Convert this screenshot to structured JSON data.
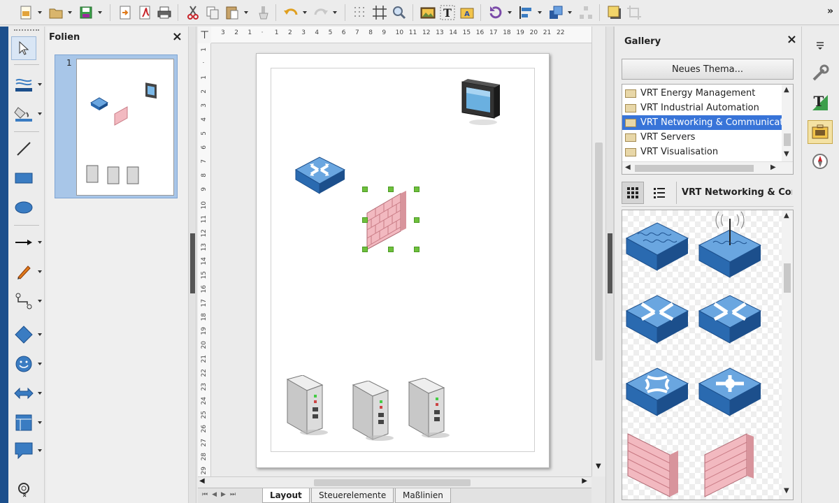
{
  "toolbar": {
    "more_label": "»",
    "icons": [
      "new-document-icon",
      "open-folder-icon",
      "save-icon",
      "export-icon",
      "export-pdf-icon",
      "print-icon",
      "cut-icon",
      "copy-icon",
      "paste-icon",
      "clone-formatting-icon",
      "undo-icon",
      "redo-icon",
      "grid-icon",
      "helplines-icon",
      "zoom-icon",
      "image-icon",
      "text-box-icon",
      "fontwork-icon",
      "rotate-icon",
      "align-icon",
      "arrange-icon",
      "distribute-icon",
      "shadow-icon",
      "crop-icon"
    ]
  },
  "tools": {
    "icons": [
      "select-icon",
      "line-color-icon",
      "fill-color-icon",
      "line-icon",
      "rectangle-icon",
      "ellipse-icon",
      "line-arrow-icon",
      "curve-icon",
      "connector-icon",
      "basic-shapes-icon",
      "symbol-shapes-icon",
      "block-arrows-icon",
      "flowchart-icon",
      "callout-icon",
      "glue-points-icon"
    ],
    "more_label": "«"
  },
  "slides_pane": {
    "title": "Folien",
    "close_label": "×",
    "slide_number": "1"
  },
  "ruler": {
    "h_ticks": [
      "3",
      "2",
      "1",
      "",
      "1",
      "2",
      "3",
      "4",
      "5",
      "6",
      "7",
      "8",
      "9",
      "10",
      "11",
      "12",
      "13",
      "14",
      "15",
      "16",
      "17",
      "18",
      "19",
      "20",
      "21",
      "22"
    ],
    "v_ticks": [
      "1",
      "",
      "1",
      "2",
      "3",
      "4",
      "5",
      "6",
      "7",
      "8",
      "9",
      "10",
      "11",
      "12",
      "13",
      "14",
      "15",
      "16",
      "17",
      "18",
      "19",
      "20",
      "21",
      "22",
      "23",
      "24",
      "25",
      "26",
      "27",
      "28",
      "29"
    ]
  },
  "canvas": {
    "shapes": [
      "monitor-shape",
      "router-shape",
      "firewall-shape",
      "server-1-shape",
      "server-2-shape",
      "server-3-shape"
    ]
  },
  "tabs": [
    {
      "label": "Layout",
      "active": true
    },
    {
      "label": "Steuerelemente",
      "active": false
    },
    {
      "label": "Maßlinien",
      "active": false
    }
  ],
  "gallery": {
    "title": "Gallery",
    "close_label": "×",
    "new_theme_button": "Neues Thema...",
    "themes": [
      {
        "label": "VRT Energy Management",
        "selected": false
      },
      {
        "label": "VRT Industrial Automation",
        "selected": false
      },
      {
        "label": "VRT Networking & Communications",
        "selected": true
      },
      {
        "label": "VRT Servers",
        "selected": false
      },
      {
        "label": "VRT Visualisation",
        "selected": false
      }
    ],
    "current_theme_label": "VRT Networking & Communications",
    "items": [
      "switch-item",
      "wireless-switch-item",
      "router-item",
      "router-2-item",
      "router-3-item",
      "router-4-item",
      "firewall-item",
      "firewall-2-item"
    ]
  },
  "sidebar": {
    "icons": [
      "sidebar-menu-icon",
      "properties-icon",
      "styles-icon",
      "gallery-icon",
      "navigator-icon"
    ]
  },
  "colors": {
    "accent": "#3874d8",
    "selection_handle": "#6ec03c",
    "network_blue": "#3a7cc2",
    "firewall_pink": "#f2b9c0"
  }
}
